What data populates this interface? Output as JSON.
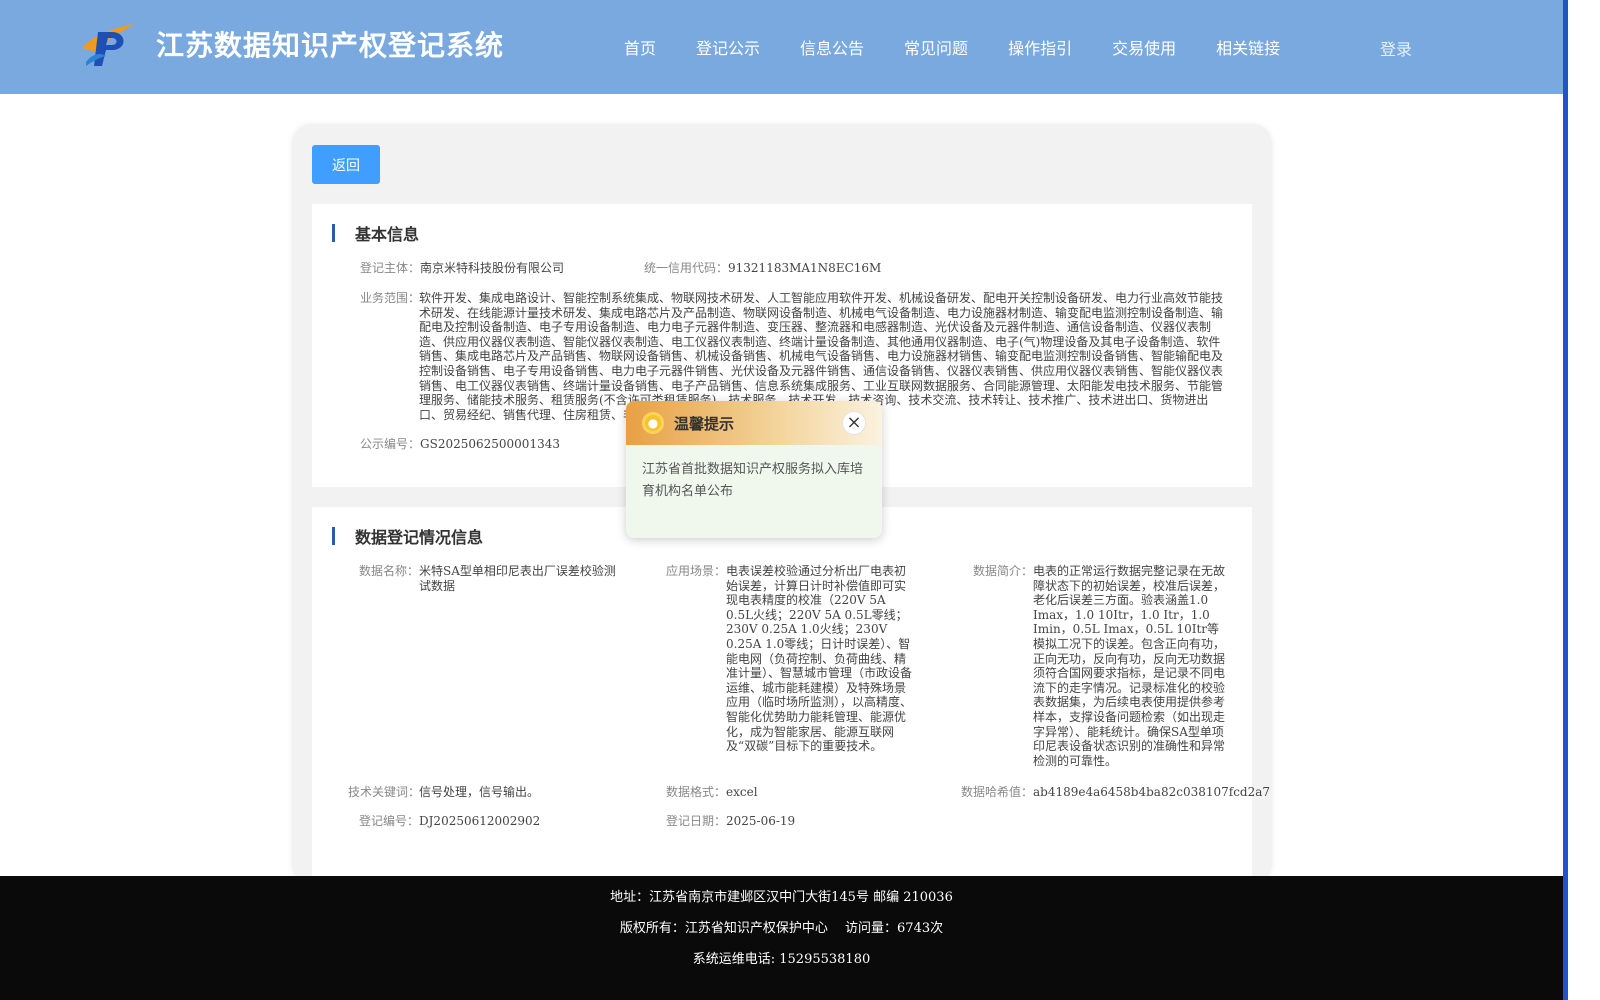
{
  "header": {
    "title": "江苏数据知识产权登记系统",
    "nav": [
      "首页",
      "登记公示",
      "信息公告",
      "常见问题",
      "操作指引",
      "交易使用",
      "相关链接"
    ],
    "login": "登录",
    "logo_icon": "p-logo-icon"
  },
  "back_button": "返回",
  "basic": {
    "title": "基本信息",
    "subject_label": "登记主体：",
    "subject": "南京米特科技股份有限公司",
    "credit_label": "统一信用代码：",
    "credit": "91321183MA1N8EC16M",
    "scope_label": "业务范围：",
    "scope": "软件开发、集成电路设计、智能控制系统集成、物联网技术研发、人工智能应用软件开发、机械设备研发、配电开关控制设备研发、电力行业高效节能技术研发、在线能源计量技术研发、集成电路芯片及产品制造、物联网设备制造、机械电气设备制造、电力设施器材制造、输变配电监测控制设备制造、输配电及控制设备制造、电子专用设备制造、电力电子元器件制造、变压器、整流器和电感器制造、光伏设备及元器件制造、通信设备制造、仪器仪表制造、供应用仪器仪表制造、智能仪器仪表制造、电工仪器仪表制造、终端计量设备制造、其他通用仪器制造、电子(气)物理设备及其电子设备制造、软件销售、集成电路芯片及产品销售、物联网设备销售、机械设备销售、机械电气设备销售、电力设施器材销售、输变配电监测控制设备销售、智能输配电及控制设备销售、电子专用设备销售、电力电子元器件销售、光伏设备及元器件销售、通信设备销售、仪器仪表销售、供应用仪器仪表销售、智能仪器仪表销售、电工仪器仪表销售、终端计量设备销售、电子产品销售、信息系统集成服务、工业互联网数据服务、合同能源管理、太阳能发电技术服务、节能管理服务、储能技术服务、租赁服务(不含许可类租赁服务)、技术服务、技术开发、技术咨询、技术交流、技术转让、技术推广、技术进出口、货物进出口、贸易经纪、销售代理、住房租赁、非居住房地产租赁。",
    "notice_label": "公示编号：",
    "notice": "GS2025062500001343"
  },
  "register": {
    "title": "数据登记情况信息",
    "name_label": "数据名称：",
    "name": "米特SA型单相印尼表出厂误差校验测试数据",
    "scene_label": "应用场景：",
    "scene": "电表误差校验通过分析出厂电表初始误差，计算日计时补偿值即可实现电表精度的校准（220V 5A 0.5L火线；220V 5A 0.5L零线；230V 0.25A 1.0火线；230V 0.25A 1.0零线；日计时误差）、智能电网（负荷控制、负荷曲线、精准计量）、智慧城市管理（市政设备运维、城市能耗建模）及特殊场景应用（临时场所监测），以高精度、智能化优势助力能耗管理、能源优化，成为智能家居、能源互联网及“双碳”目标下的重要技术。",
    "intro_label": "数据简介：",
    "intro": "电表的正常运行数据完整记录在无故障状态下的初始误差，校准后误差，老化后误差三方面。验表涵盖1.0 Imax，1.0 10Itr，1.0 Itr，1.0 Imin，0.5L Imax，0.5L 10Itr等模拟工况下的误差。包含正向有功，正向无功，反向有功，反向无功数据须符合国网要求指标，是记录不同电流下的走字情况。记录标准化的校验表数据集，为后续电表使用提供参考样本，支撑设备问题检索（如出现走字异常）、能耗统计。确保SA型单项印尼表设备状态识别的准确性和异常检测的可靠性。",
    "keyword_label": "技术关键词：",
    "keyword": "信号处理，信号输出。",
    "format_label": "数据格式：",
    "format": "excel",
    "hash_label": "数据哈希值：",
    "hash": "ab4189e4a6458b4ba82c038107fcd2a7",
    "regno_label": "登记编号：",
    "regno": "DJ20250612002902",
    "date_label": "登记日期：",
    "date": "2025-06-19"
  },
  "popup": {
    "title": "温馨提示",
    "body": "江苏省首批数据知识产权服务拟入库培育机构名单公布",
    "close": "×"
  },
  "footer": {
    "address": "地址：江苏省南京市建邺区汉中门大街145号 邮编 210036",
    "copyright": "版权所有：江苏省知识产权保护中心　 访问量：6743次",
    "phone": "系统运维电话: 15295538180"
  }
}
